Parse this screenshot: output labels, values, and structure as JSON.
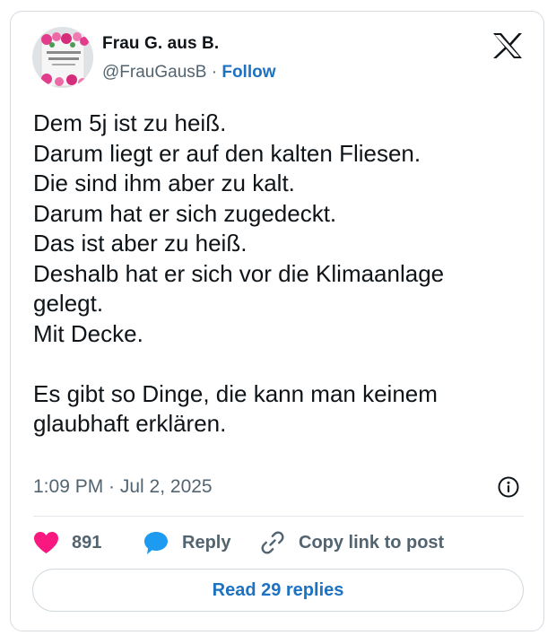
{
  "author": {
    "display_name": "Frau G. aus B.",
    "handle": "@FrauGausB",
    "separator": "·",
    "follow_label": "Follow",
    "avatar_icon": "profile-photo-mug"
  },
  "brand": {
    "logo_icon": "x-logo-icon"
  },
  "post": {
    "lines": [
      "Dem 5j ist zu heiß.",
      "Darum liegt er auf den kalten Fliesen.",
      "Die sind ihm aber zu kalt.",
      "Darum hat er sich zugedeckt.",
      "Das ist aber zu heiß.",
      "Deshalb hat er sich vor die Klimaanlage",
      "gelegt.",
      "Mit Decke.",
      "",
      "Es gibt so Dinge, die kann man keinem",
      "glaubhaft erklären."
    ],
    "timestamp": "1:09 PM · Jul 2, 2025"
  },
  "actions": {
    "like_count": "891",
    "reply_label": "Reply",
    "copy_link_label": "Copy link to post"
  },
  "footer": {
    "read_replies_label": "Read 29 replies"
  },
  "colors": {
    "like": "#f91880",
    "reply": "#1d9bf0",
    "link": "#1d72c2",
    "muted": "#536471",
    "text": "#0f1419",
    "border": "#d6dbe0"
  }
}
